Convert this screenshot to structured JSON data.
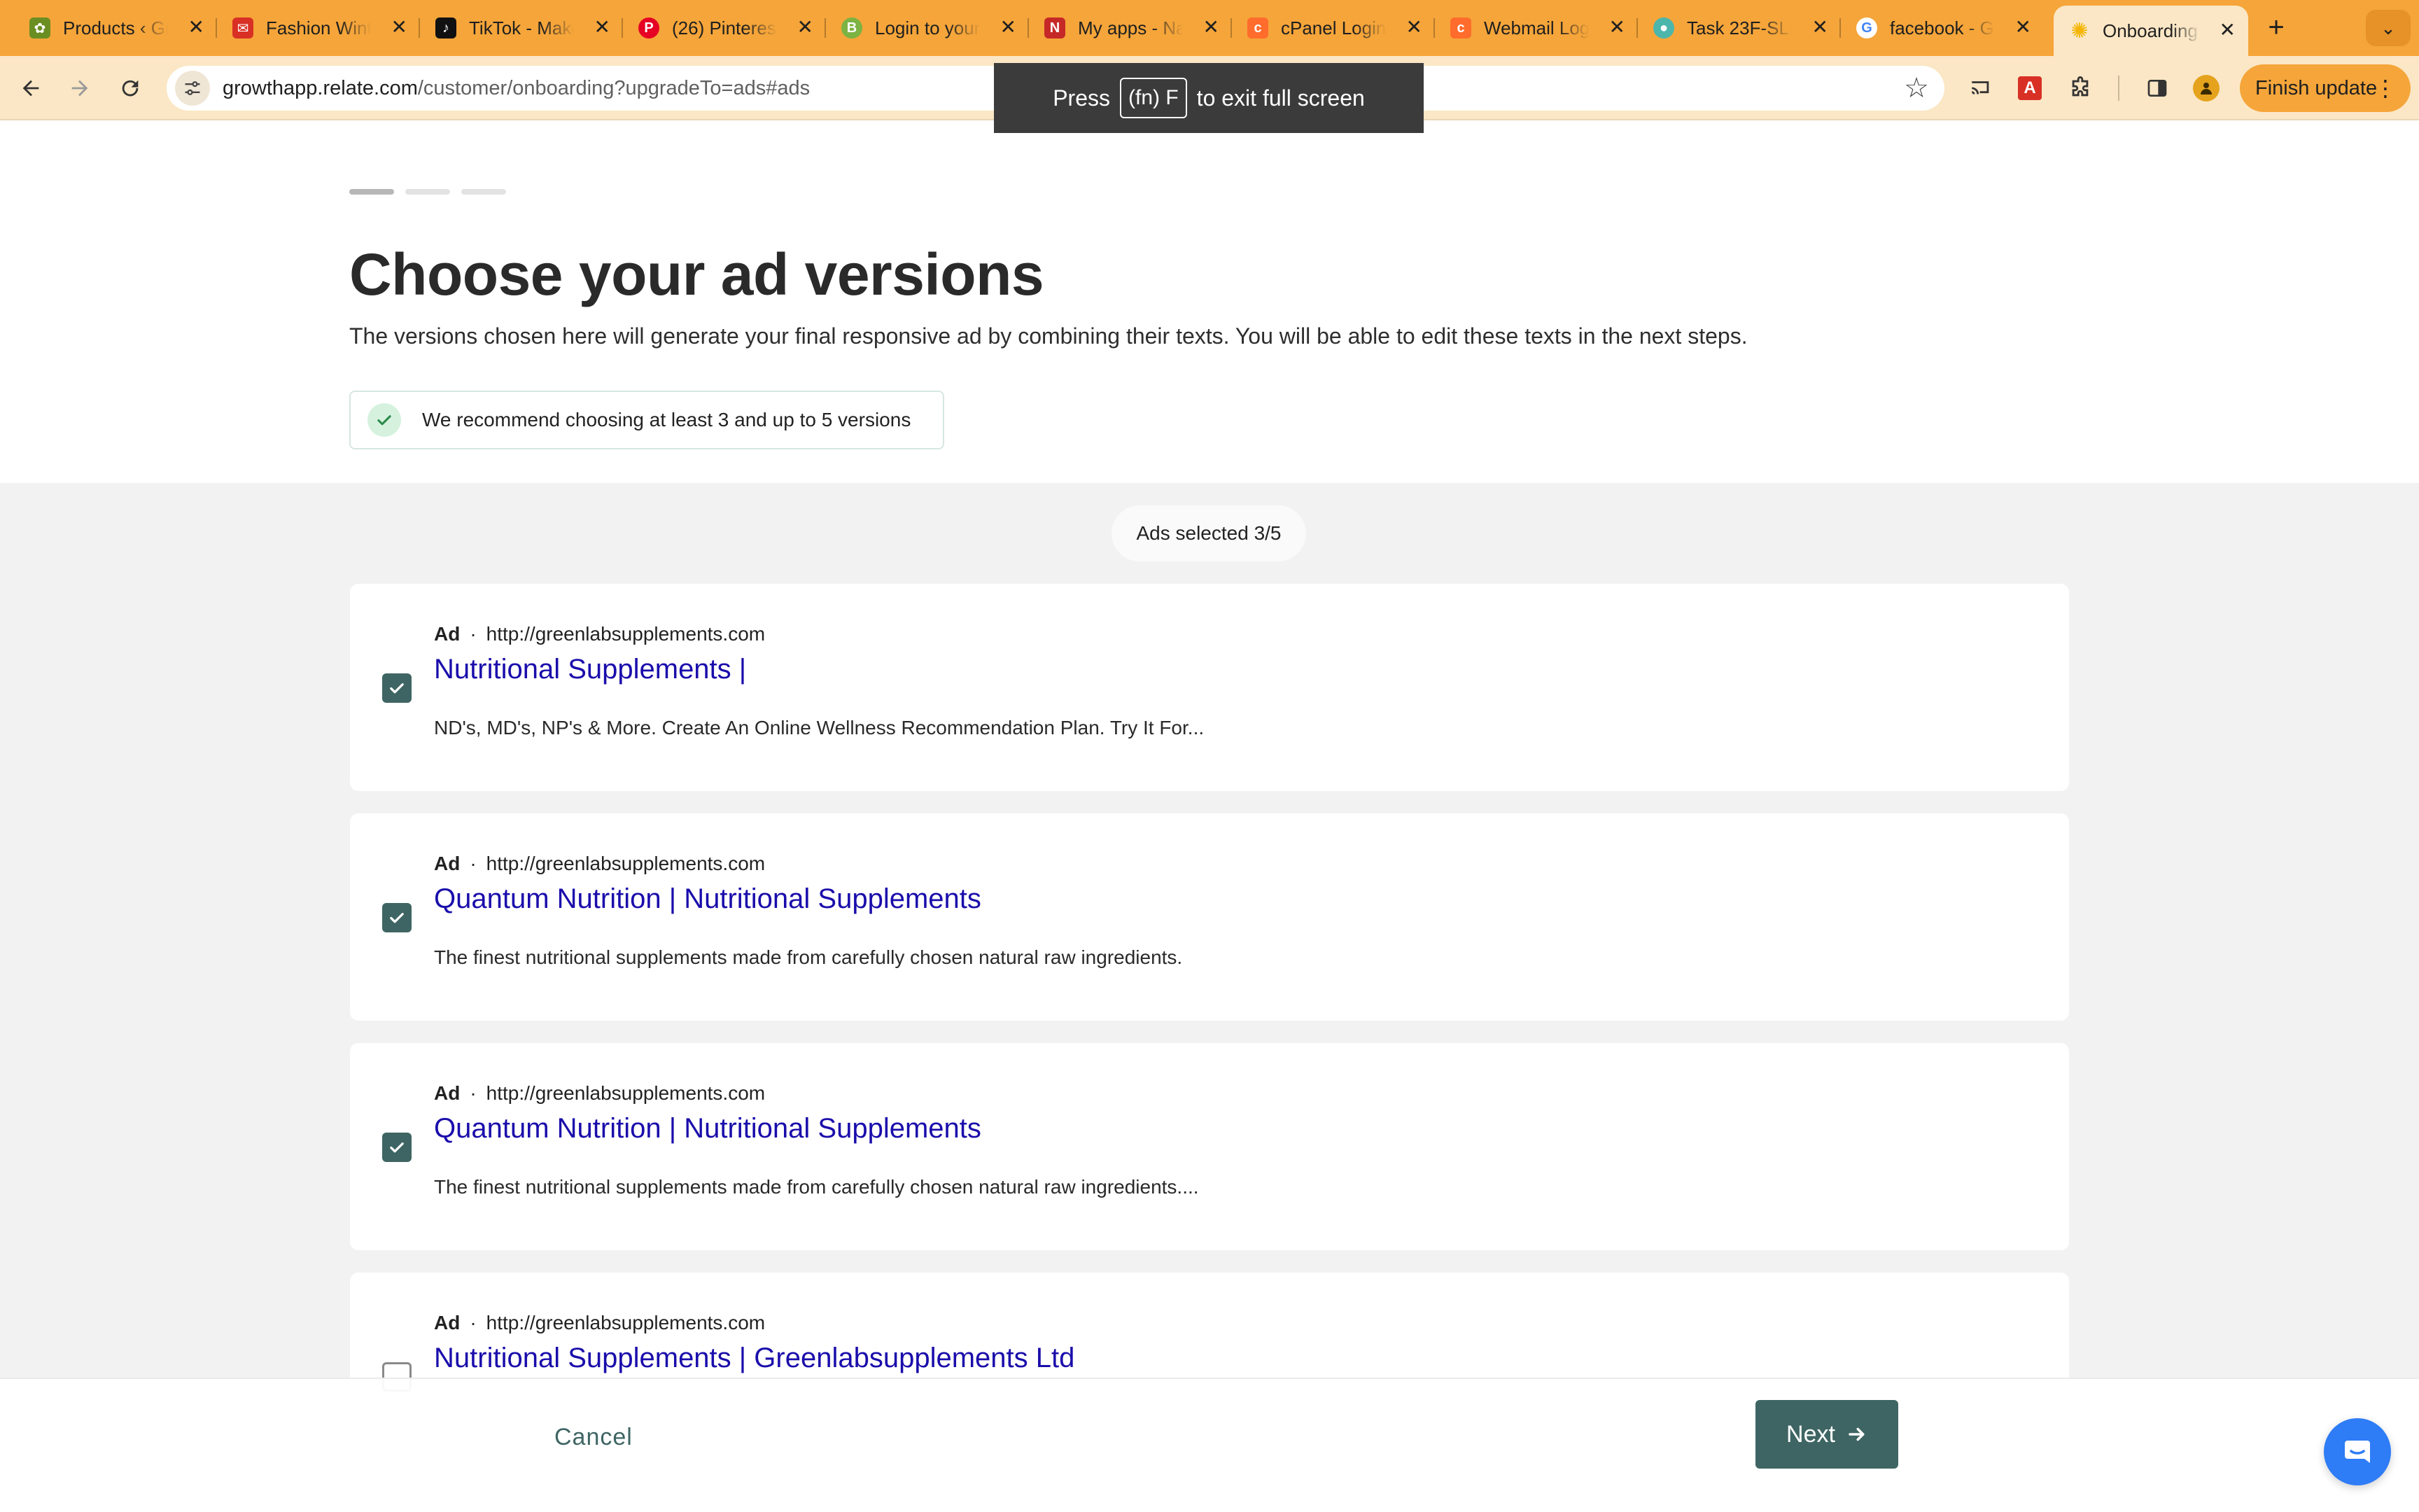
{
  "browser": {
    "tabs": [
      {
        "title": "Products ‹ Gr",
        "icon": "woocommerce-favicon-icon",
        "color": "#6b8e23"
      },
      {
        "title": "Fashion Winte",
        "icon": "mail-favicon-icon",
        "color": "#d93025"
      },
      {
        "title": "TikTok - Make",
        "icon": "tiktok-favicon-icon",
        "color": "#111111"
      },
      {
        "title": "(26) Pinteres",
        "icon": "pinterest-favicon-icon",
        "color": "#e60023"
      },
      {
        "title": "Login to your",
        "icon": "b-favicon-icon",
        "color": "#7cb342"
      },
      {
        "title": "My apps - Na",
        "icon": "apps-favicon-icon",
        "color": "#c62828"
      },
      {
        "title": "cPanel Login",
        "icon": "cpanel-favicon-icon",
        "color": "#ff6c2c"
      },
      {
        "title": "Webmail Log",
        "icon": "cpanel-favicon-icon",
        "color": "#ff6c2c"
      },
      {
        "title": "Task 23F-SLF",
        "icon": "globe-favicon-icon",
        "color": "#4db6ac"
      },
      {
        "title": "facebook - G",
        "icon": "google-favicon-icon",
        "color": "#4285f4"
      },
      {
        "title": "Onboarding |",
        "icon": "relate-favicon-icon",
        "color": "#f4b400"
      }
    ],
    "url_host": "growthapp.relate.com",
    "url_path": "/customer/onboarding?upgradeTo=ads#ads",
    "finish_update_label": "Finish update",
    "fullscreen_toast": {
      "prefix": "Press",
      "key": "(fn) F",
      "suffix": "to exit full screen"
    }
  },
  "page": {
    "title": "Choose your ad versions",
    "subtitle": "The versions chosen here will generate your final responsive ad by combining their texts. You will be able to edit these texts in the next steps.",
    "recommendation": "We recommend choosing at least 3 and up to 5 versions",
    "selected_count": "Ads selected 3/5",
    "ads": [
      {
        "label": "Ad",
        "url": "http://greenlabsupplements.com",
        "headline": "Nutritional Supplements |",
        "description": "ND's, MD's, NP's & More. Create An Online Wellness Recommendation Plan. Try It For...",
        "checked": true
      },
      {
        "label": "Ad",
        "url": "http://greenlabsupplements.com",
        "headline": "Quantum Nutrition | Nutritional Supplements",
        "description": "The finest nutritional supplements made from carefully chosen natural raw ingredients.",
        "checked": true
      },
      {
        "label": "Ad",
        "url": "http://greenlabsupplements.com",
        "headline": "Quantum Nutrition | Nutritional Supplements",
        "description": "The finest nutritional supplements made from carefully chosen natural raw ingredients....",
        "checked": true
      },
      {
        "label": "Ad",
        "url": "http://greenlabsupplements.com",
        "headline": "Nutritional Supplements | Greenlabsupplements Ltd",
        "description": "",
        "checked": false
      }
    ],
    "cancel_label": "Cancel",
    "next_label": "Next"
  },
  "colors": {
    "accent": "#3e6563",
    "tabbar": "#f5a53a",
    "headline_link": "#1a0dab",
    "chat": "#2e7cf6"
  }
}
